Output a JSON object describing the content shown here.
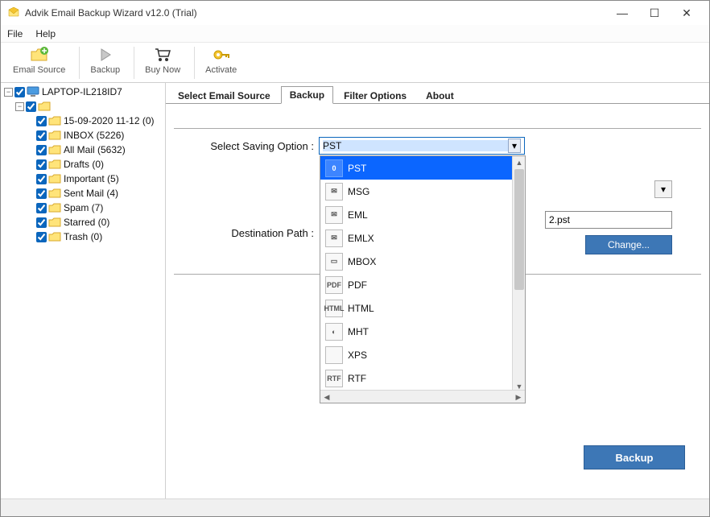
{
  "window": {
    "title": "Advik Email Backup Wizard v12.0 (Trial)"
  },
  "menubar": {
    "file": "File",
    "help": "Help"
  },
  "toolbar": {
    "email_source": "Email Source",
    "backup": "Backup",
    "buy_now": "Buy Now",
    "activate": "Activate"
  },
  "tree": {
    "root": "LAPTOP-IL218ID7",
    "items": [
      {
        "label": "15-09-2020 11-12 (0)"
      },
      {
        "label": "INBOX (5226)"
      },
      {
        "label": "All Mail (5632)"
      },
      {
        "label": "Drafts (0)"
      },
      {
        "label": "Important (5)"
      },
      {
        "label": "Sent Mail (4)"
      },
      {
        "label": "Spam (7)"
      },
      {
        "label": "Starred (0)"
      },
      {
        "label": "Trash (0)"
      }
    ]
  },
  "tabs": {
    "select_source": "Select Email Source",
    "backup": "Backup",
    "filter": "Filter Options",
    "about": "About"
  },
  "form": {
    "saving_label": "Select Saving Option :",
    "saving_value": "PST",
    "dest_label": "Destination Path :",
    "dest_value": "2.pst",
    "change": "Change...",
    "backup_btn": "Backup"
  },
  "dropdown": {
    "options": [
      {
        "label": "PST",
        "icon": "0"
      },
      {
        "label": "MSG",
        "icon": "✉"
      },
      {
        "label": "EML",
        "icon": "✉"
      },
      {
        "label": "EMLX",
        "icon": "✉"
      },
      {
        "label": "MBOX",
        "icon": "▭"
      },
      {
        "label": "PDF",
        "icon": "PDF"
      },
      {
        "label": "HTML",
        "icon": "HTML"
      },
      {
        "label": "MHT",
        "icon": "◐"
      },
      {
        "label": "XPS",
        "icon": "</>"
      },
      {
        "label": "RTF",
        "icon": "RTF"
      }
    ]
  }
}
